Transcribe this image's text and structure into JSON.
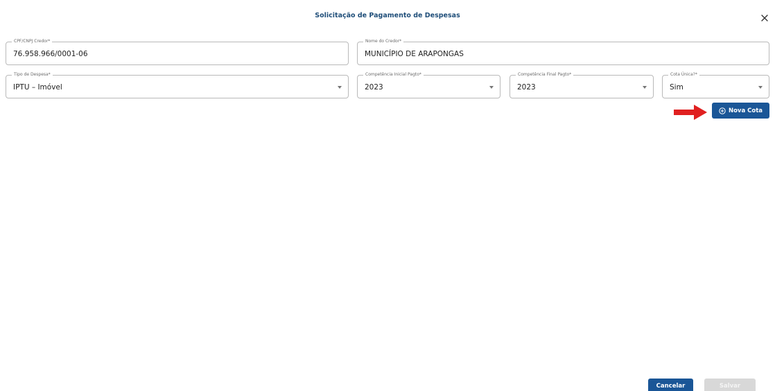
{
  "dialog": {
    "title": "Solicitação de Pagamento de Despesas",
    "close_glyph": "✕"
  },
  "fields": {
    "cpf": {
      "label": "CPF/CNPJ Credor*",
      "value": "76.958.966/0001-06"
    },
    "credor": {
      "label": "Nome do Credor*",
      "value": "MUNICÍPIO DE ARAPONGAS"
    },
    "tipo": {
      "label": "Tipo de Despesa*",
      "value": "IPTU – Imóvel"
    },
    "comp_inicial": {
      "label": "Competência Inicial Pagto*",
      "value": "2023"
    },
    "comp_final": {
      "label": "Competência Final Pagto*",
      "value": "2023"
    },
    "cota_unica": {
      "label": "Cota Única?*",
      "value": "Sim"
    }
  },
  "actions": {
    "nova_cota": "Nova Cota",
    "cancelar": "Cancelar",
    "salvar": "Salvar"
  },
  "colors": {
    "primary": "#1a5697",
    "title": "#1f4e79",
    "arrow": "#e02020",
    "disabled": "#d8d8d8"
  },
  "icons": {
    "close": "close-icon",
    "nova_cota": "plus-circle-icon",
    "annotation": "red-arrow-icon",
    "dropdown": "chevron-down-icon"
  }
}
